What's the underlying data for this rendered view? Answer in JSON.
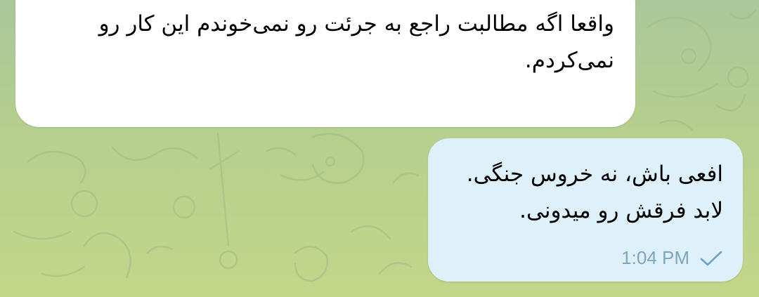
{
  "chat": {
    "messages": [
      {
        "direction": "incoming",
        "text": "واقعا اگه مطالبت راجع به جرئت رو نمی‌خوندم این کار رو\nنمی‌کردم."
      },
      {
        "direction": "outgoing",
        "text": "افعی باش، نه خروس جنگی.\nلابد فرقش رو میدونی.",
        "time": "1:04 PM",
        "status_icon": "single-check-icon"
      }
    ]
  },
  "colors": {
    "background": "#b6cf8e",
    "incoming_bubble": "#ffffff",
    "outgoing_bubble": "#def0fa",
    "time_text": "#7fa5bc",
    "check": "#6ea3c6"
  }
}
